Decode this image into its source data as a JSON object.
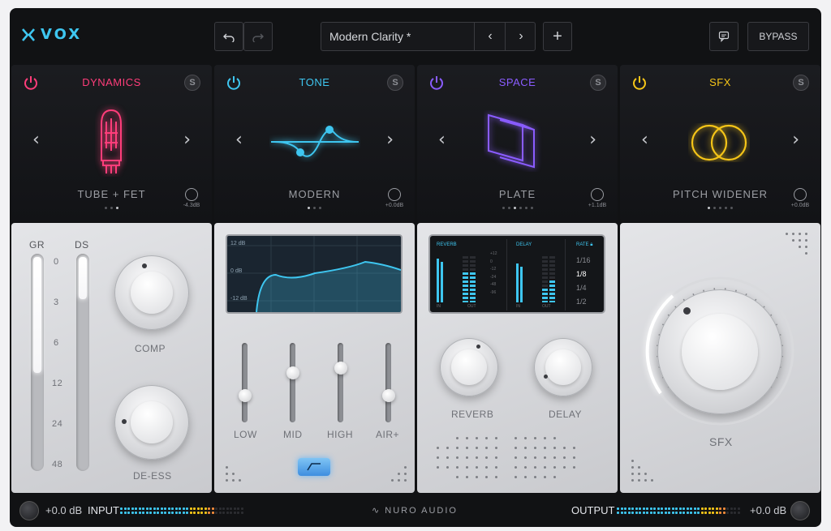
{
  "app": {
    "name": "VOX",
    "brand_color": "#3ec6f0"
  },
  "toolbar": {
    "undo_icon": "undo-icon",
    "redo_icon": "redo-icon",
    "preset_name": "Modern Clarity *",
    "prev_icon": "chevron-left-icon",
    "next_icon": "chevron-right-icon",
    "add_icon": "plus-icon",
    "chat_icon": "chat-icon",
    "bypass_label": "BYPASS"
  },
  "modules": [
    {
      "title": "DYNAMICS",
      "color": "#ff3d7a",
      "mode": "TUBE + FET",
      "gain": "-4.3dB",
      "dots": 3,
      "active_dot": 2,
      "icon": "vacuum-tube-icon",
      "solo": "S"
    },
    {
      "title": "TONE",
      "color": "#3ec6f0",
      "mode": "MODERN",
      "gain": "+0.0dB",
      "dots": 3,
      "active_dot": 0,
      "icon": "eq-curve-icon",
      "solo": "S"
    },
    {
      "title": "SPACE",
      "color": "#8a5cff",
      "mode": "PLATE",
      "gain": "+1.1dB",
      "dots": 6,
      "active_dot": 2,
      "icon": "plate-reverb-icon",
      "solo": "S"
    },
    {
      "title": "SFX",
      "color": "#f5c518",
      "mode": "PITCH WIDENER",
      "gain": "+0.0dB",
      "dots": 5,
      "active_dot": 0,
      "icon": "rings-icon",
      "solo": "S"
    }
  ],
  "dynamics": {
    "gr_label": "GR",
    "ds_label": "DS",
    "scale": [
      "0",
      "3",
      "6",
      "12",
      "24",
      "48"
    ],
    "gr_level": 0.55,
    "ds_level": 0.2,
    "comp_label": "COMP",
    "deess_label": "DE-ESS"
  },
  "tone": {
    "eq_labels": [
      "12 dB",
      "0 dB",
      "-12 dB"
    ],
    "faders": [
      {
        "label": "LOW",
        "level": 0.3
      },
      {
        "label": "MID",
        "level": 0.65
      },
      {
        "label": "HIGH",
        "level": 0.72
      },
      {
        "label": "AIR+",
        "level": 0.3
      }
    ]
  },
  "space": {
    "reverb_label": "REVERB",
    "delay_label": "DELAY",
    "rate_label": "RATE",
    "rates": [
      "1/16",
      "1/8",
      "1/4",
      "1/2"
    ],
    "rate_selected": "1/8",
    "meter_scale": [
      "+12",
      "0",
      "-12",
      "-24",
      "-48",
      "-96"
    ],
    "in_label": "IN",
    "out_label": "OUT",
    "reverb_knob_label": "REVERB",
    "delay_knob_label": "DELAY"
  },
  "sfx": {
    "knob_label": "SFX"
  },
  "footer": {
    "input_gain": "+0.0 dB",
    "input_label": "INPUT",
    "brand": "NURO AUDIO",
    "output_label": "OUTPUT",
    "output_gain": "+0.0 dB"
  }
}
